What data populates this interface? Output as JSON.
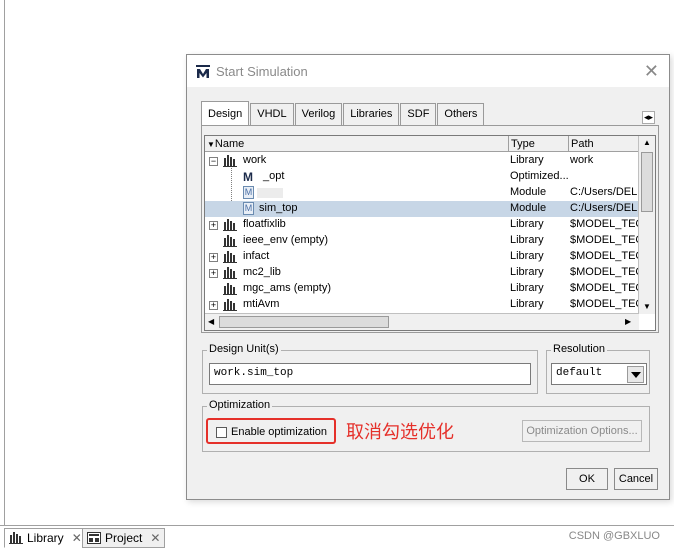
{
  "dialog": {
    "title": "Start Simulation",
    "close": "✕",
    "tabs": [
      "Design",
      "VHDL",
      "Verilog",
      "Libraries",
      "SDF",
      "Others"
    ],
    "tab_scroll": "◂▸"
  },
  "tree": {
    "columns": [
      "Name",
      "Type",
      "Path"
    ],
    "rows": [
      {
        "name": "work",
        "type": "Library",
        "path": "work"
      },
      {
        "name": "_opt",
        "type": "Optimized...",
        "path": ""
      },
      {
        "name": "",
        "type": "Module",
        "path": "C:/Users/DEL"
      },
      {
        "name": "sim_top",
        "type": "Module",
        "path": "C:/Users/DEL"
      },
      {
        "name": "floatfixlib",
        "type": "Library",
        "path": "$MODEL_TEC"
      },
      {
        "name": "ieee_env  (empty)",
        "type": "Library",
        "path": "$MODEL_TEC"
      },
      {
        "name": "infact",
        "type": "Library",
        "path": "$MODEL_TEC"
      },
      {
        "name": "mc2_lib",
        "type": "Library",
        "path": "$MODEL_TEC"
      },
      {
        "name": "mgc_ams  (empty)",
        "type": "Library",
        "path": "$MODEL_TEC"
      },
      {
        "name": "mtiAvm",
        "type": "Library",
        "path": "$MODEL_TEC"
      }
    ]
  },
  "design_unit": {
    "label": "Design Unit(s)",
    "value": "work.sim_top"
  },
  "resolution": {
    "label": "Resolution",
    "value": "default"
  },
  "optimization": {
    "label": "Optimization",
    "checkbox_label": "Enable optimization",
    "checked": false,
    "options_button": "Optimization Options..."
  },
  "annotation": "取消勾选优化",
  "buttons": {
    "ok": "OK",
    "cancel": "Cancel"
  },
  "taskbar": {
    "tabs": [
      "Library",
      "Project"
    ]
  },
  "watermark": "CSDN @GBXLUO"
}
